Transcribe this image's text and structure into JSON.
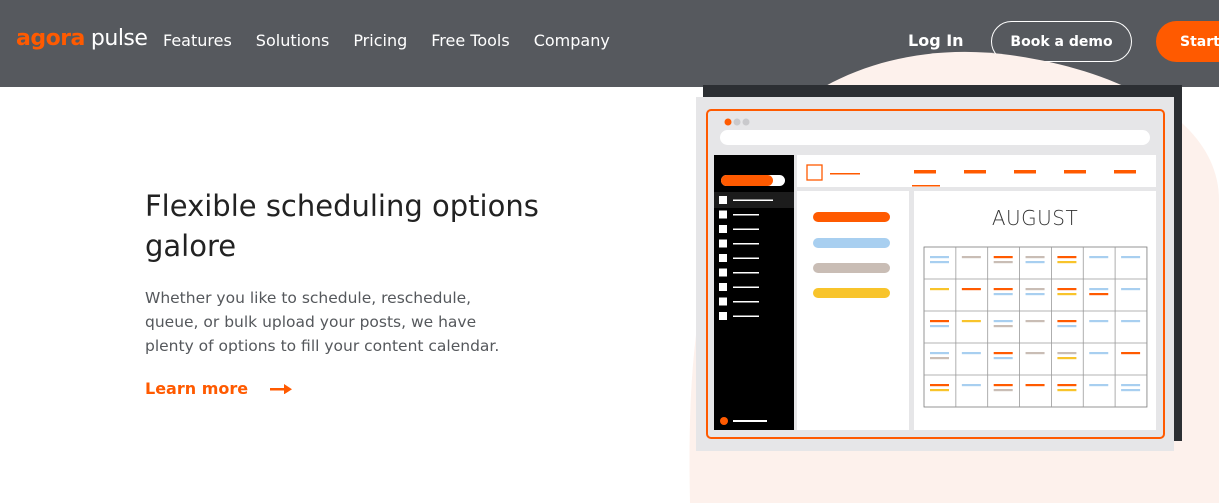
{
  "logo": {
    "part1": "agora",
    "part2": "pulse"
  },
  "nav": {
    "items": [
      {
        "label": "Features"
      },
      {
        "label": "Solutions"
      },
      {
        "label": "Pricing"
      },
      {
        "label": "Free Tools"
      },
      {
        "label": "Company"
      }
    ],
    "login": "Log In",
    "demo_button": "Book a demo",
    "start_button": "Start"
  },
  "hero": {
    "title": "Flexible scheduling options galore",
    "description": "Whether you like to schedule, reschedule, queue, or bulk upload your posts, we have plenty of options to fill your content calendar.",
    "learn_more": "Learn more"
  },
  "calendar": {
    "month": "AUGUST"
  },
  "colors": {
    "brand_orange": "#ff5a00",
    "nav_bg": "#56595e",
    "blue": "#a8cff0",
    "taupe": "#c9bdb5",
    "yellow": "#f8c42b"
  }
}
